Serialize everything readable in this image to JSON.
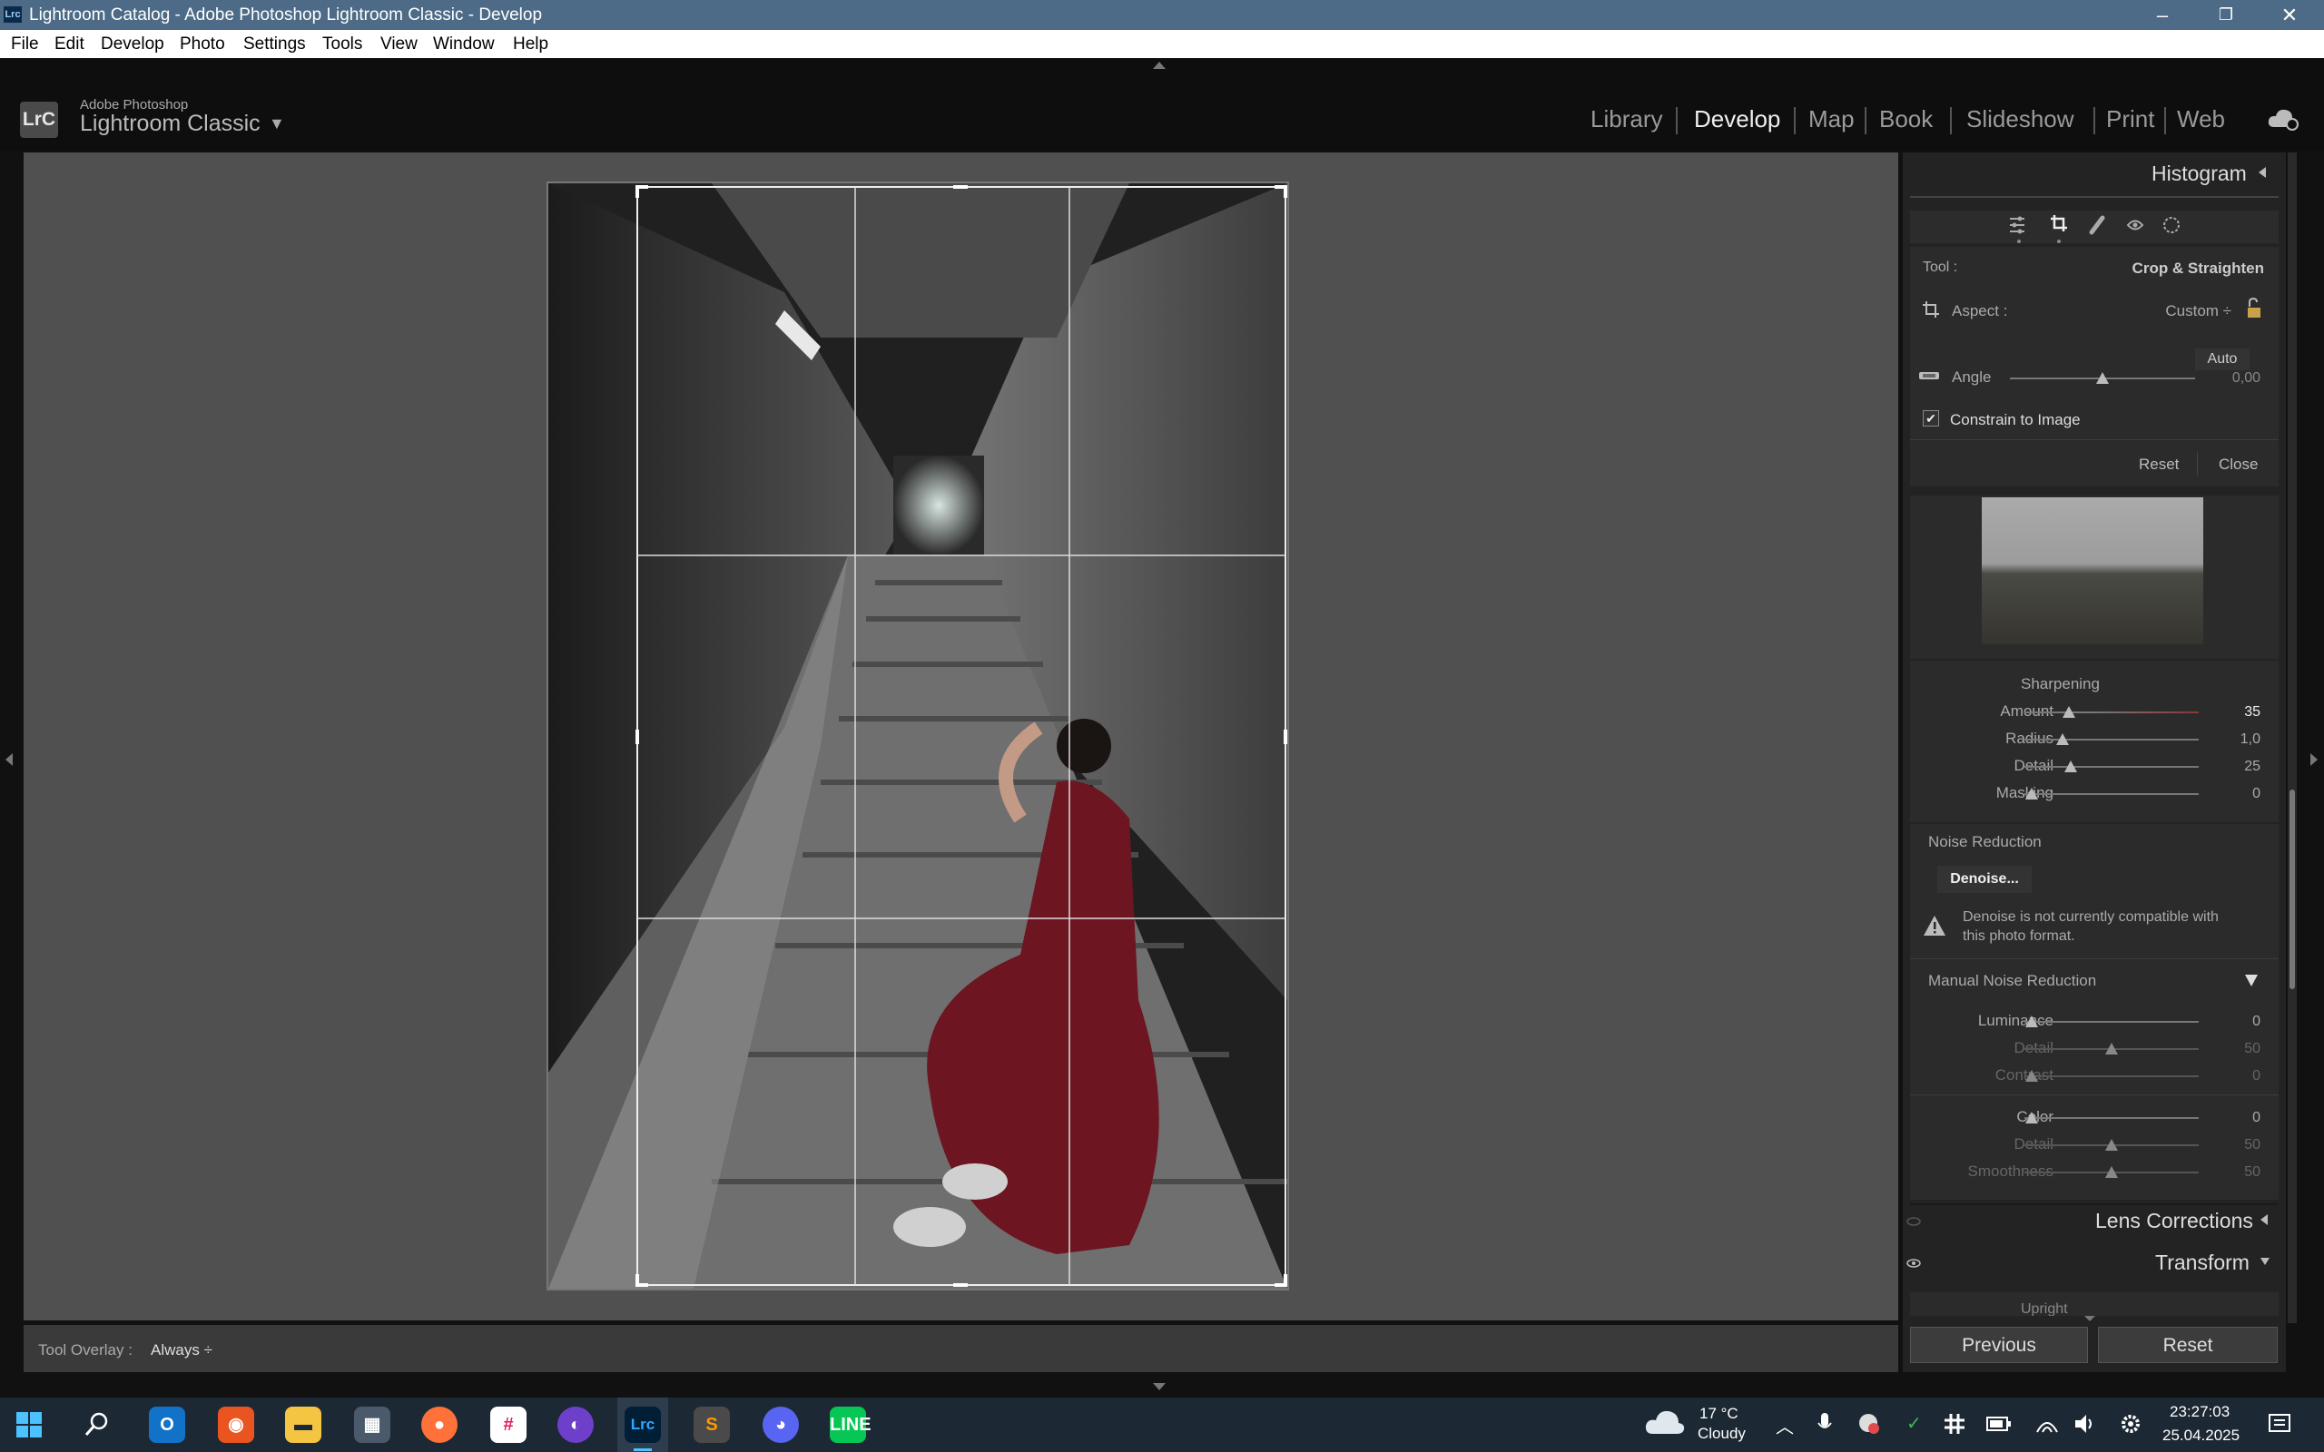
{
  "window": {
    "title": "Lightroom Catalog - Adobe Photoshop Lightroom Classic - Develop",
    "minimize": "–",
    "restore": "❐",
    "close": "✕"
  },
  "menu": [
    "File",
    "Edit",
    "Develop",
    "Photo",
    "Settings",
    "Tools",
    "View",
    "Window",
    "Help"
  ],
  "brand": {
    "logo": "LrC",
    "small": "Adobe Photoshop",
    "big": "Lightroom Classic",
    "arrow": "▼"
  },
  "modules": [
    "Library",
    "Develop",
    "Map",
    "Book",
    "Slideshow",
    "Print",
    "Web"
  ],
  "active_module": "Develop",
  "toolbar": {
    "overlay_label": "Tool Overlay :",
    "overlay_value": "Always ÷"
  },
  "right_panel": {
    "histogram": "Histogram",
    "crop": {
      "tool_label": "Tool :",
      "tool_value": "Crop & Straighten",
      "aspect_label": "Aspect :",
      "aspect_value": "Custom ÷",
      "auto": "Auto",
      "angle_label": "Angle",
      "angle_value": "0,00",
      "constrain": "Constrain to Image",
      "reset": "Reset",
      "close": "Close"
    },
    "sharpening": {
      "title": "Sharpening",
      "rows": [
        {
          "label": "Amount",
          "value": "35"
        },
        {
          "label": "Radius",
          "value": "1,0"
        },
        {
          "label": "Detail",
          "value": "25"
        },
        {
          "label": "Masking",
          "value": "0"
        }
      ]
    },
    "noise": {
      "title": "Noise Reduction",
      "denoise": "Denoise...",
      "warning": "Denoise is not currently compatible with this photo format.",
      "manual": "Manual Noise Reduction",
      "rows": [
        {
          "label": "Luminance",
          "value": "0"
        },
        {
          "label": "Detail",
          "value": "50"
        },
        {
          "label": "Contrast",
          "value": "0"
        },
        {
          "label": "Color",
          "value": "0"
        },
        {
          "label": "Detail",
          "value": "50"
        },
        {
          "label": "Smoothness",
          "value": "50"
        }
      ]
    },
    "lens": "Lens Corrections",
    "transform": "Transform",
    "upright": "Upright",
    "previous": "Previous",
    "reset_btn": "Reset"
  },
  "taskbar": {
    "weather_temp": "17 °C",
    "weather_text": "Cloudy",
    "time": "23:27:03",
    "date": "25.04.2025",
    "apps": [
      "start",
      "search",
      "outlook",
      "ubuntu",
      "files",
      "calculator",
      "firefox",
      "slack",
      "github",
      "lightroom",
      "sublime",
      "discord",
      "line"
    ]
  }
}
